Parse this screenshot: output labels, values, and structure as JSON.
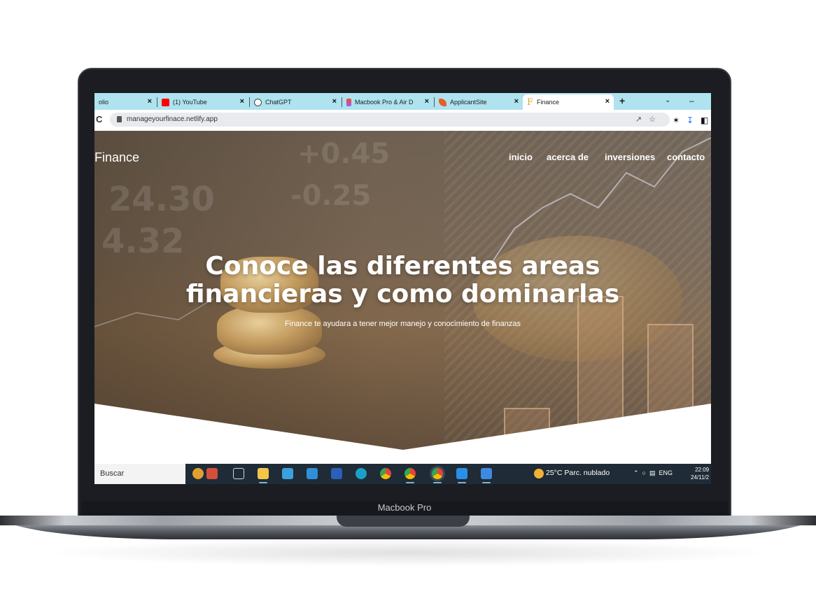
{
  "browser": {
    "tabs": [
      {
        "title": "olio",
        "favicon_color": "#aee3ef",
        "active": false
      },
      {
        "title": "(1) YouTube",
        "favicon_color": "#ff0000",
        "active": false
      },
      {
        "title": "ChatGPT",
        "favicon_color": "#444444",
        "active": false
      },
      {
        "title": "Macbook Pro & Air D",
        "favicon_color": "#f24e1e",
        "active": false
      },
      {
        "title": "ApplicantSite",
        "favicon_color": "#e85d2a",
        "active": false
      },
      {
        "title": "Finance",
        "favicon_color": "#e8b64a",
        "active": true
      }
    ],
    "new_tab": "+",
    "close_glyph": "×",
    "address": "manageyourfinace.netlify.app"
  },
  "site": {
    "brand": "Finance",
    "nav": [
      "inicio",
      "acerca de",
      "inversiones",
      "contacto"
    ],
    "headline_line1": "Conoce las diferentes areas",
    "headline_line2": "financieras y como dominarlas",
    "subtitle": "Finance te ayudara a tener mejor manejo y conocimiento de finanzas"
  },
  "taskbar": {
    "search_label": "Buscar",
    "weather": "25°C  Parc. nublado",
    "lang": "ENG",
    "time": "22:09",
    "date": "24/11/2"
  },
  "device_label": "Macbook Pro"
}
